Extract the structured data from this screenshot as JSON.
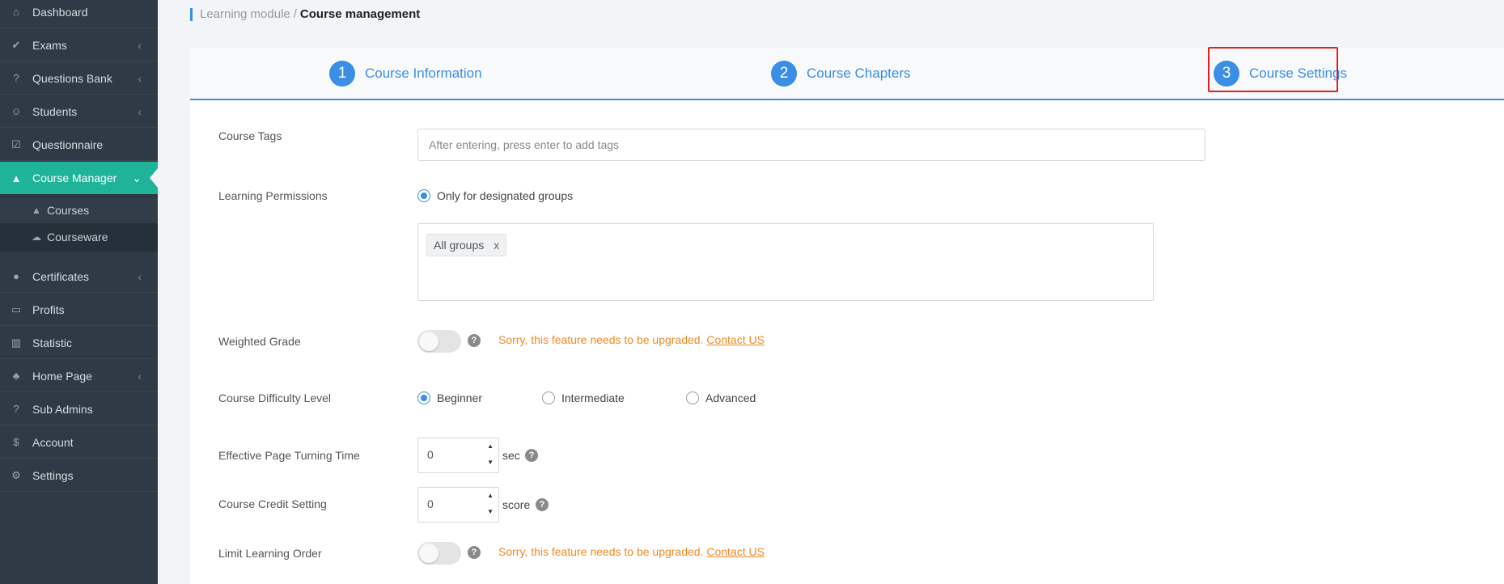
{
  "sidebar": {
    "items": [
      {
        "label": "Dashboard",
        "icon": "home-icon"
      },
      {
        "label": "Exams",
        "icon": "check-circle-icon"
      },
      {
        "label": "Questions Bank",
        "icon": "question-circle-icon"
      },
      {
        "label": "Students",
        "icon": "users-icon"
      },
      {
        "label": "Questionnaire",
        "icon": "checkbox-icon"
      },
      {
        "label": "Course Manager",
        "icon": "graduation-cap-icon"
      },
      {
        "label": "Certificates",
        "icon": "certificate-icon"
      },
      {
        "label": "Profits",
        "icon": "credit-card-icon"
      },
      {
        "label": "Statistic",
        "icon": "bar-chart-icon"
      },
      {
        "label": "Home Page",
        "icon": "home-page-icon"
      },
      {
        "label": "Sub Admins",
        "icon": "question-circle-icon"
      },
      {
        "label": "Account",
        "icon": "dollar-icon"
      },
      {
        "label": "Settings",
        "icon": "gear-icon"
      }
    ],
    "sub_items": [
      {
        "label": "Courses",
        "icon": "graduation-cap-icon"
      },
      {
        "label": "Courseware",
        "icon": "cloud-icon"
      }
    ]
  },
  "breadcrumb": {
    "parent": "Learning module",
    "separator": "/",
    "current": "Course management"
  },
  "steps": [
    {
      "number": "1",
      "label": "Course Information"
    },
    {
      "number": "2",
      "label": "Course Chapters"
    },
    {
      "number": "3",
      "label": "Course Settings"
    }
  ],
  "form": {
    "course_tags": {
      "label": "Course Tags",
      "placeholder": "After entering, press enter to add tags"
    },
    "learning_permissions": {
      "label": "Learning Permissions",
      "option": "Only for designated groups",
      "tag": "All groups",
      "tag_remove": "x"
    },
    "weighted_grade": {
      "label": "Weighted Grade",
      "warning": "Sorry, this feature needs to be upgraded.",
      "link": "Contact US"
    },
    "difficulty": {
      "label": "Course Difficulty Level",
      "options": [
        "Beginner",
        "Intermediate",
        "Advanced"
      ],
      "selected": "Beginner"
    },
    "page_turning": {
      "label": "Effective Page Turning Time",
      "value": "0",
      "unit": "sec"
    },
    "credit": {
      "label": "Course Credit Setting",
      "value": "0",
      "unit": "score"
    },
    "limit_order": {
      "label": "Limit Learning Order",
      "warning": "Sorry, this feature needs to be upgraded.",
      "link": "Contact US"
    },
    "help_glyph": "?"
  },
  "colors": {
    "sidebar_bg": "#2f3a46",
    "active_bg": "#1fb39a",
    "accent": "#3a8ee6",
    "warning": "#f08a24",
    "highlight": "#e02020"
  }
}
